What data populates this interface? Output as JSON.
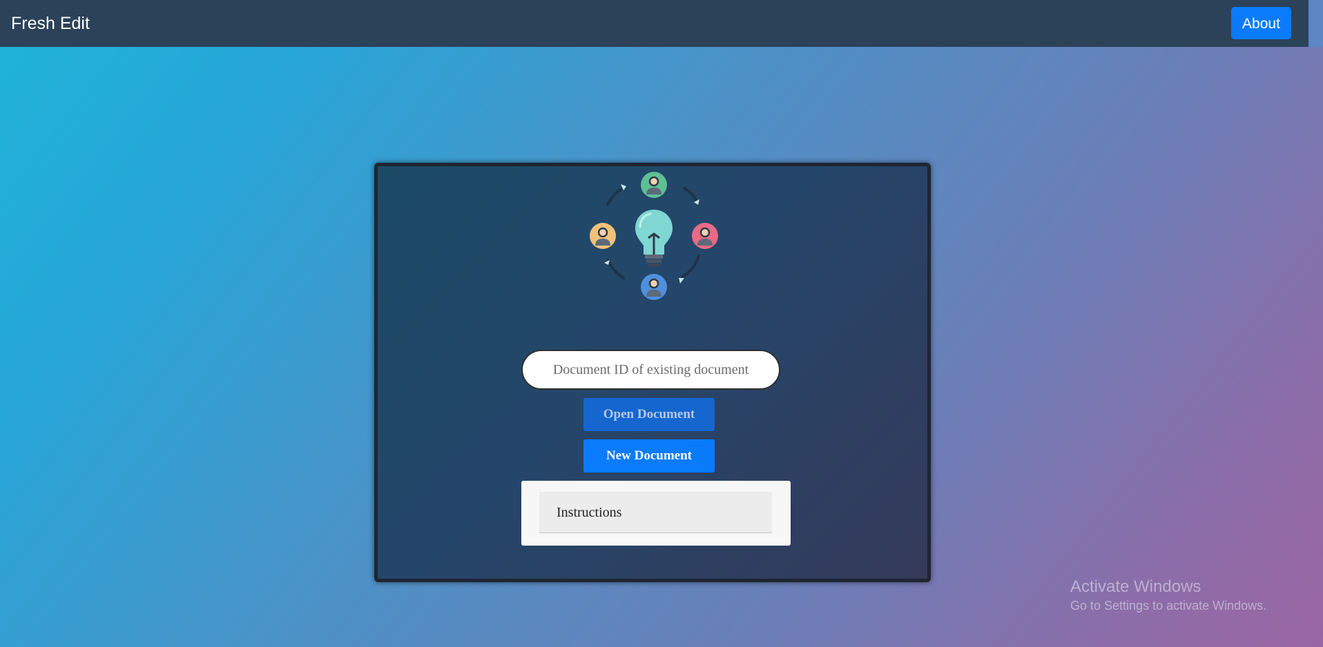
{
  "navbar": {
    "brand": "Fresh Edit",
    "about_label": "About"
  },
  "main": {
    "illustration_icons": [
      "lightbulb-icon",
      "user-avatar-icon",
      "arrow-icon"
    ],
    "document_input": {
      "value": "",
      "placeholder": "Document ID of existing document"
    },
    "open_button_label": "Open Document",
    "new_button_label": "New Document",
    "instructions_label": "Instructions"
  },
  "watermark": {
    "title": "Activate Windows",
    "subtitle": "Go to Settings to activate Windows."
  },
  "colors": {
    "navbar_bg": "#2c4259",
    "accent_blue": "#0a7bfa",
    "open_button_bg": "#1566cf",
    "card_border": "#1f2533",
    "avatar_green": "#5fbf95",
    "avatar_yellow": "#f2c27a",
    "avatar_pink": "#e86a85",
    "avatar_blue": "#4f8fdc",
    "bulb_teal": "#7fd6d2"
  }
}
